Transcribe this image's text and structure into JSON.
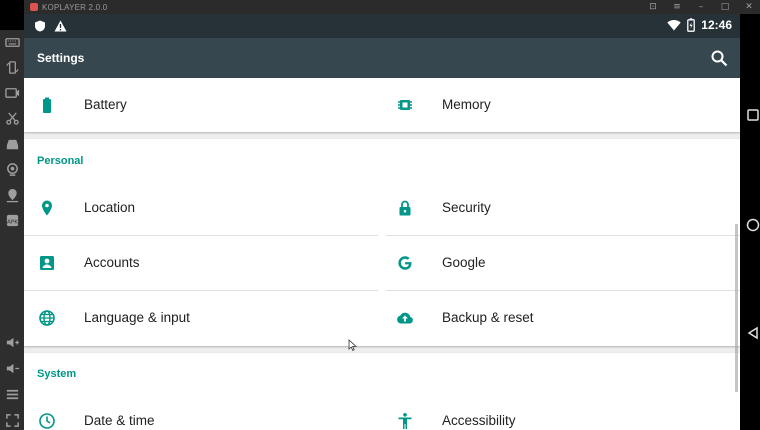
{
  "emulator": {
    "title": "KOPLAYER 2.0.0"
  },
  "status_bar": {
    "time": "12:46"
  },
  "app_bar": {
    "title": "Settings"
  },
  "sections": {
    "device_partial": {
      "items": [
        {
          "label": "Battery",
          "icon": "battery-icon"
        },
        {
          "label": "Memory",
          "icon": "memory-icon"
        }
      ]
    },
    "personal": {
      "header": "Personal",
      "items": [
        {
          "label": "Location",
          "icon": "location-icon"
        },
        {
          "label": "Security",
          "icon": "lock-icon"
        },
        {
          "label": "Accounts",
          "icon": "accounts-icon"
        },
        {
          "label": "Google",
          "icon": "google-icon"
        },
        {
          "label": "Language & input",
          "icon": "globe-icon"
        },
        {
          "label": "Backup & reset",
          "icon": "cloud-upload-icon"
        }
      ]
    },
    "system": {
      "header": "System",
      "items": [
        {
          "label": "Date & time",
          "icon": "clock-icon"
        },
        {
          "label": "Accessibility",
          "icon": "accessibility-icon"
        }
      ]
    }
  },
  "colors": {
    "accent": "#009688",
    "status_bar": "#263238",
    "app_bar": "#37474f",
    "background": "#eeeeee"
  }
}
